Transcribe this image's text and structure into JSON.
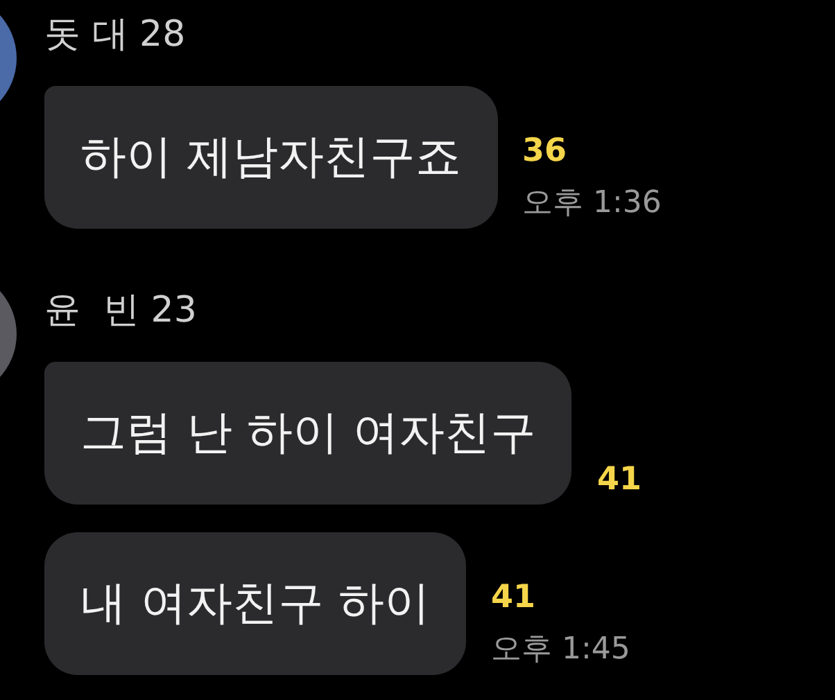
{
  "groups": [
    {
      "sender": "돗 대 28",
      "avatar": {
        "color": "#4a6aa8"
      },
      "messages": [
        {
          "text": "하이 제남자친구죠",
          "unread": "36",
          "time": "오후 1:36"
        }
      ]
    },
    {
      "sender": "윤  빈 23",
      "avatar": {
        "color": "#5a5a60"
      },
      "messages": [
        {
          "text": "그럼 난 하이 여자친구",
          "unread": "41"
        },
        {
          "text": "내 여자친구 하이",
          "unread": "41",
          "time": "오후 1:45"
        }
      ]
    }
  ]
}
